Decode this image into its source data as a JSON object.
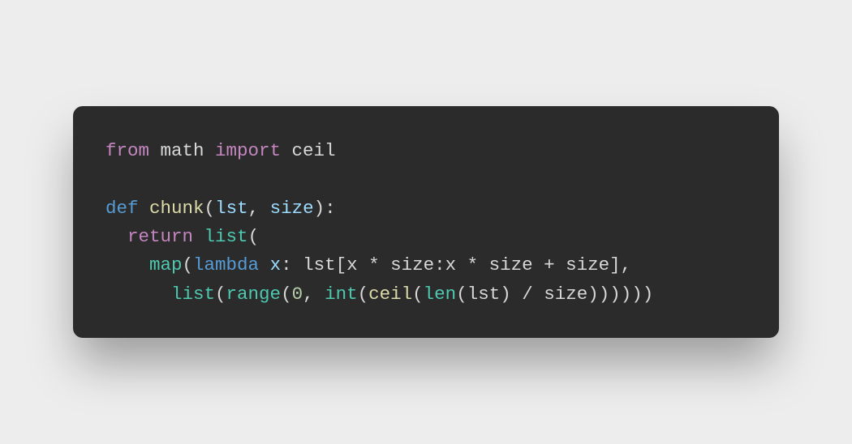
{
  "code": {
    "line1": {
      "kw1": "from",
      "mod": " math ",
      "kw2": "import",
      "name": " ceil"
    },
    "blank1": "",
    "line3": {
      "kw": "def",
      "sp": " ",
      "fn": "chunk",
      "open": "(",
      "p1": "lst",
      "comma": ", ",
      "p2": "size",
      "close": "):"
    },
    "line4": {
      "indent": "  ",
      "kw": "return",
      "sp": " ",
      "fn": "list",
      "open": "("
    },
    "line5": {
      "indent": "    ",
      "fn": "map",
      "open": "(",
      "kw": "lambda",
      "sp": " ",
      "p": "x",
      "colon": ": ",
      "seg1": "lst[x * size:x * size + size],"
    },
    "line6": {
      "indent": "      ",
      "fn1": "list",
      "open1": "(",
      "fn2": "range",
      "open2": "(",
      "n0": "0",
      "comma": ", ",
      "fn3": "int",
      "open3": "(",
      "fn4": "ceil",
      "open4": "(",
      "fn5": "len",
      "open5": "(",
      "arg": "lst) / size))))))"
    }
  }
}
